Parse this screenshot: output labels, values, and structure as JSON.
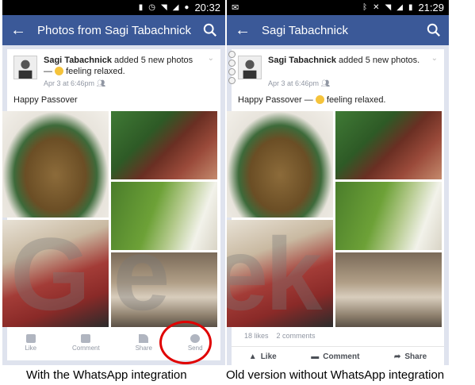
{
  "left": {
    "status_time": "20:32",
    "title": "Photos from Sagi Tabachnick",
    "post": {
      "author": "Sagi Tabachnick",
      "action": " added 5 new photos — ",
      "feeling": " feeling relaxed.",
      "date": "Apr 3 at 6:46pm",
      "text": "Happy Passover"
    },
    "actions": {
      "like": "Like",
      "comment": "Comment",
      "share": "Share",
      "send": "Send"
    },
    "caption": "With the WhatsApp integration"
  },
  "right": {
    "status_time": "21:29",
    "title": "Sagi Tabachnick",
    "post": {
      "author": "Sagi Tabachnick",
      "action": " added 5 new photos.",
      "date": "Apr 3 at 6:46pm",
      "text": "Happy Passover — ",
      "feeling": " feeling relaxed."
    },
    "likes": "18 likes",
    "comments": "2 comments",
    "actions": {
      "like": "Like",
      "comment": "Comment",
      "share": "Share"
    },
    "caption": "Old version without WhatsApp integration"
  },
  "colors": {
    "facebook_blue": "#3b5998",
    "highlight_red": "#e00000"
  }
}
